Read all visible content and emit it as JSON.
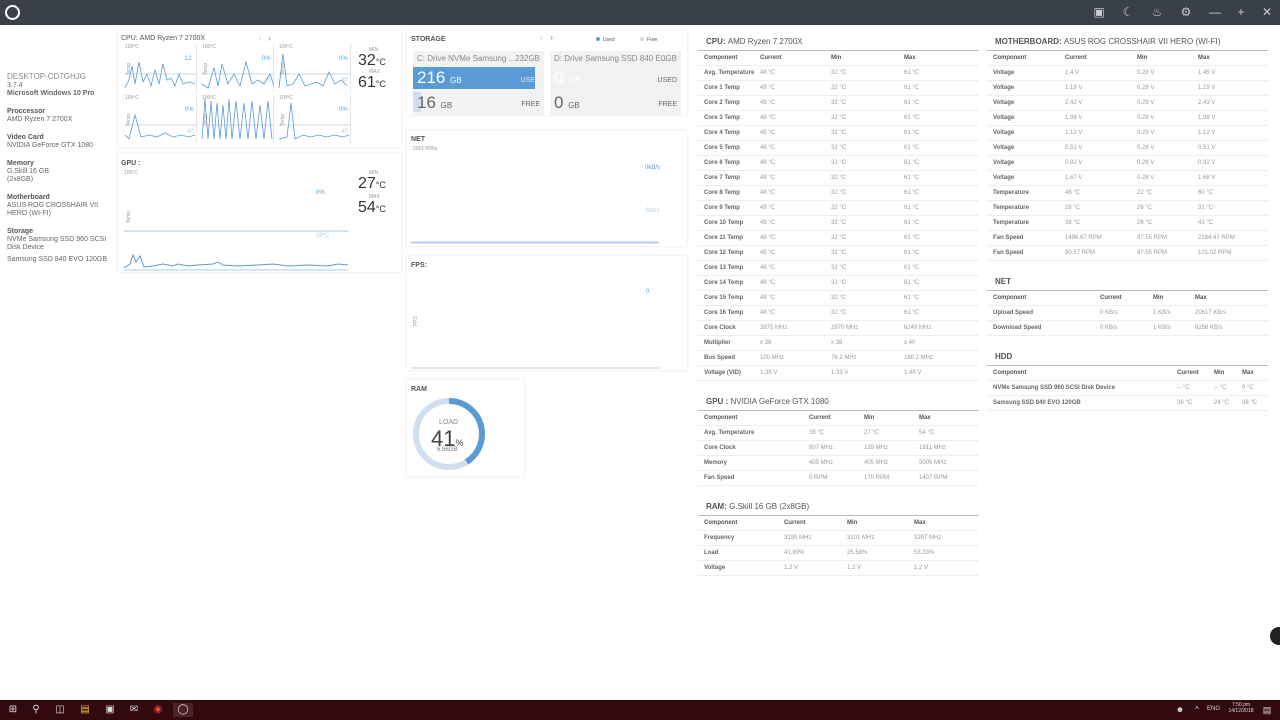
{
  "colors": {
    "accent": "#5b9bd5",
    "titlebar": "#3a4049",
    "taskbar": "#31090f"
  },
  "titlebar": {
    "icons": [
      "camera-icon",
      "moon-icon",
      "bell-icon",
      "gear-icon",
      "minimize-icon",
      "maximize-icon",
      "close-icon"
    ]
  },
  "sidebar": {
    "pc_name": "DESKTOP-CD7GHJG",
    "version": "3.7.4",
    "os": "Microsoft Windows 10 Pro",
    "processor_label": "Proccessor",
    "processor": "AMD Ryzen 7 2700X",
    "video_label": "Video Card",
    "video": "NVIDIA GeForce GTX 1080",
    "memory_label": "Memory",
    "memory1": "G.Skill 16 GB",
    "memory2": "(2x8GB)",
    "mobo_label": "Motherboard",
    "mobo1": "ASUS ROG CROSSHAIR VII",
    "mobo2": "HERO (WI-FI)",
    "storage_label": "Storage",
    "storage1": "NVMe Samsung SSD 960 SCSI",
    "storage2": "Disk Device",
    "storage3": "Samsung SSD 840 EVO 120GB"
  },
  "cpu_panel": {
    "title": "CPU:",
    "name": "AMD Ryzen 7 2700X",
    "min_label": "MIN",
    "min_val": "32",
    "max_label": "MAX",
    "max_val": "61",
    "unit": "°C",
    "minis": [
      {
        "top": "100ºC",
        "pct": "12",
        "lo": ""
      },
      {
        "top": "100ºC",
        "pct": "0%",
        "lo": "40"
      },
      {
        "top": "100ºC",
        "pct": "0%",
        "lo": "40"
      },
      {
        "top": "100ºC",
        "pct": "0%",
        "lo": "40"
      },
      {
        "top": "100ºC",
        "pct": "",
        "lo": ""
      },
      {
        "top": "100ºC",
        "pct": "0%",
        "lo": "40"
      }
    ],
    "temp_label": "Temp"
  },
  "gpu_panel": {
    "title": "GPU :",
    "scale": "100ºC",
    "pct": "0%",
    "lo": "38ºC",
    "temp_label": "Temp",
    "min_label": "MIN",
    "min_val": "27",
    "max_label": "MAX",
    "max_val": "54",
    "unit": "°C"
  },
  "storage": {
    "title": "STORAGE",
    "legend_used": "Used",
    "legend_free": "Free",
    "drives": [
      {
        "name": "C: Drive NVMe Samsung ...",
        "size": "232GB",
        "used": "216",
        "free": "16",
        "unit": "GB",
        "used_label": "USED",
        "free_label": "FREE",
        "used_fraction": 0.93
      },
      {
        "name": "D: Drive Samsung SSD 840 E...",
        "size": "0GB",
        "used": "0",
        "free": "0",
        "unit": "GB",
        "used_label": "USED",
        "free_label": "FREE",
        "used_fraction": 0
      }
    ]
  },
  "net": {
    "title": "NET",
    "scale": "20617KB/s",
    "up": "0kB/s",
    "down": "0kb/s"
  },
  "fps": {
    "title": "FPS:",
    "value": "0",
    "axis": "FPS"
  },
  "ram": {
    "title": "RAM",
    "load_label": "LOAD",
    "value": "41",
    "unit": "%",
    "used": "6.86GB",
    "fraction": 0.41
  },
  "cpu_table": {
    "title": "CPU:",
    "name": "AMD Ryzen 7 2700X",
    "headers": [
      "Component",
      "Current",
      "Min",
      "Max"
    ],
    "rows": [
      [
        "Avg. Temperature",
        "48 °C",
        "32 °C",
        "61 °C"
      ],
      [
        "Core 1 Temp",
        "48 °C",
        "32 °C",
        "61 °C"
      ],
      [
        "Core 2 Temp",
        "48 °C",
        "32 °C",
        "61 °C"
      ],
      [
        "Core 3 Temp",
        "48 °C",
        "32 °C",
        "61 °C"
      ],
      [
        "Core 4 Temp",
        "48 °C",
        "32 °C",
        "61 °C"
      ],
      [
        "Core 5 Temp",
        "48 °C",
        "32 °C",
        "61 °C"
      ],
      [
        "Core 6 Temp",
        "48 °C",
        "32 °C",
        "61 °C"
      ],
      [
        "Core 7 Temp",
        "48 °C",
        "32 °C",
        "61 °C"
      ],
      [
        "Core 8 Temp",
        "48 °C",
        "32 °C",
        "61 °C"
      ],
      [
        "Core 9 Temp",
        "48 °C",
        "32 °C",
        "61 °C"
      ],
      [
        "Core 10 Temp",
        "48 °C",
        "32 °C",
        "61 °C"
      ],
      [
        "Core 11 Temp",
        "48 °C",
        "32 °C",
        "61 °C"
      ],
      [
        "Core 12 Temp",
        "48 °C",
        "32 °C",
        "61 °C"
      ],
      [
        "Core 13 Temp",
        "48 °C",
        "32 °C",
        "61 °C"
      ],
      [
        "Core 14 Temp",
        "48 °C",
        "32 °C",
        "61 °C"
      ],
      [
        "Core 15 Temp",
        "48 °C",
        "32 °C",
        "61 °C"
      ],
      [
        "Core 16 Temp",
        "48 °C",
        "32 °C",
        "61 °C"
      ],
      [
        "Core Clock",
        "3875 MHz",
        "2970 MHz",
        "6249 MHz"
      ],
      [
        "Multiplier",
        "x 38",
        "x 38",
        "x 40"
      ],
      [
        "Bus Speed",
        "100 MHz",
        "76.2 MHz",
        "160.2 MHz"
      ],
      [
        "Voltage (VID)",
        "1.38 V",
        "1.33 V",
        "1.48 V"
      ]
    ]
  },
  "gpu_table": {
    "title": "GPU :",
    "name": "NVIDIA GeForce GTX 1080",
    "headers": [
      "Component",
      "Current",
      "Min",
      "Max"
    ],
    "rows": [
      [
        "Avg. Temperature",
        "38 °C",
        "27 °C",
        "54 °C"
      ],
      [
        "Core Clock",
        "607 MHz",
        "139 MHz",
        "1911 MHz"
      ],
      [
        "Memory",
        "405 MHz",
        "405 MHz",
        "5005 MHz"
      ],
      [
        "Fan Speed",
        "0 RPM",
        "170 RPM",
        "1407 RPM"
      ]
    ]
  },
  "ram_table": {
    "title": "RAM:",
    "name": "G.Skill 16 GB (2x8GB)",
    "headers": [
      "Component",
      "Current",
      "Min",
      "Max"
    ],
    "rows": [
      [
        "Frequency",
        "3198 MHz",
        "3101 MHz",
        "3287 MHz"
      ],
      [
        "Load",
        "41.89%",
        "25.58%",
        "53.33%"
      ],
      [
        "Voltage",
        "1.2 V",
        "1.2 V",
        "1.2 V"
      ]
    ]
  },
  "mobo_table": {
    "title": "MOTHERBOARD:",
    "name": "ASUS ROG CROSSHAIR VII HERO (WI-FI)",
    "headers": [
      "Component",
      "Current",
      "Min",
      "Max"
    ],
    "rows": [
      [
        "Voltage",
        "1.4 V",
        "0.28 V",
        "1.45 V"
      ],
      [
        "Voltage",
        "1.19 V",
        "0.28 V",
        "1.19 V"
      ],
      [
        "Voltage",
        "2.42 V",
        "0.28 V",
        "2.43 V"
      ],
      [
        "Voltage",
        "1.98 V",
        "0.28 V",
        "1.98 V"
      ],
      [
        "Voltage",
        "1.12 V",
        "0.28 V",
        "1.12 V"
      ],
      [
        "Voltage",
        "0.51 V",
        "0.28 V",
        "0.51 V"
      ],
      [
        "Voltage",
        "0.92 V",
        "0.28 V",
        "0.92 V"
      ],
      [
        "Voltage",
        "1.67 V",
        "0.28 V",
        "1.68 V"
      ],
      [
        "Temperature",
        "48 °C",
        "22 °C",
        "60 °C"
      ],
      [
        "Temperature",
        "28 °C",
        "26 °C",
        "31 °C"
      ],
      [
        "Temperature",
        "38 °C",
        "26 °C",
        "43 °C"
      ],
      [
        "Fan Speed",
        "1496.67 RPM",
        "87.55 RPM",
        "2184.47 RPM"
      ],
      [
        "Fan Speed",
        "90.57 RPM",
        "87.55 RPM",
        "101.02 RPM"
      ]
    ]
  },
  "net_table": {
    "title": "NET",
    "headers": [
      "Component",
      "Current",
      "Min",
      "Max"
    ],
    "rows": [
      [
        "Upload Speed",
        "0 KB/s",
        "1 KB/s",
        "20617 KB/s"
      ],
      [
        "Download Speed",
        "0 KB/s",
        "1 KB/s",
        "8258 KB/s"
      ]
    ]
  },
  "hdd_table": {
    "title": "HDD",
    "headers": [
      "Component",
      "Current",
      "Min",
      "Max"
    ],
    "rows": [
      [
        "NVMe Samsung SSD 960 SCSI Disk Device",
        "-- °C",
        "-- °C",
        "0 °C"
      ],
      [
        "Samsung SSD 840 EVO 120GB",
        "36 °C",
        "24 °C",
        "38 °C"
      ]
    ]
  },
  "taskbar": {
    "lang": "ENG",
    "time": "7:50 pm",
    "date": "14/12/2018"
  }
}
